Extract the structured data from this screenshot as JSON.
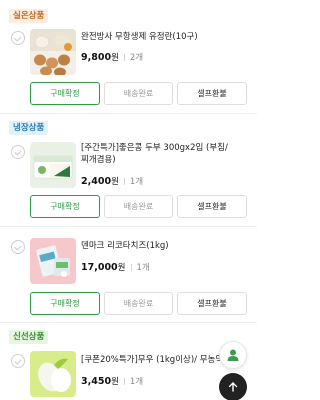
{
  "sections": [
    {
      "tag": "실온상품",
      "product": {
        "name": "완전방사 무항생제 유정란(10구)",
        "price": "9,800",
        "currency": "원",
        "quantity": "2개"
      }
    },
    {
      "tag": "냉장상품",
      "products": [
        {
          "name": "[주간특가]좋은콩 두부 300gx2입 (부침/찌개겸용)",
          "price": "2,400",
          "currency": "원",
          "quantity": "1개"
        },
        {
          "name": "덴마크 리코타치즈(1kg)",
          "price": "17,000",
          "currency": "원",
          "quantity": "1개"
        }
      ]
    },
    {
      "tag": "신선상품",
      "product": {
        "name": "[쿠폰20%특가]무우 (1kg이상)/ 무농약이",
        "price": "3,450",
        "currency": "원",
        "quantity": "1개"
      }
    }
  ],
  "actions": {
    "confirm_label": "구매확정",
    "shipping_label": "배송완료",
    "refund_label": "셀프환불"
  },
  "colors": {
    "accent_green": "#2f9a46",
    "room_tag": "#c66a1f",
    "frozen_tag": "#2d7fc1",
    "fresh_tag": "#3b8e2f"
  },
  "floating": {
    "profile_icon": "person-icon",
    "top_icon": "arrow-up-icon"
  }
}
